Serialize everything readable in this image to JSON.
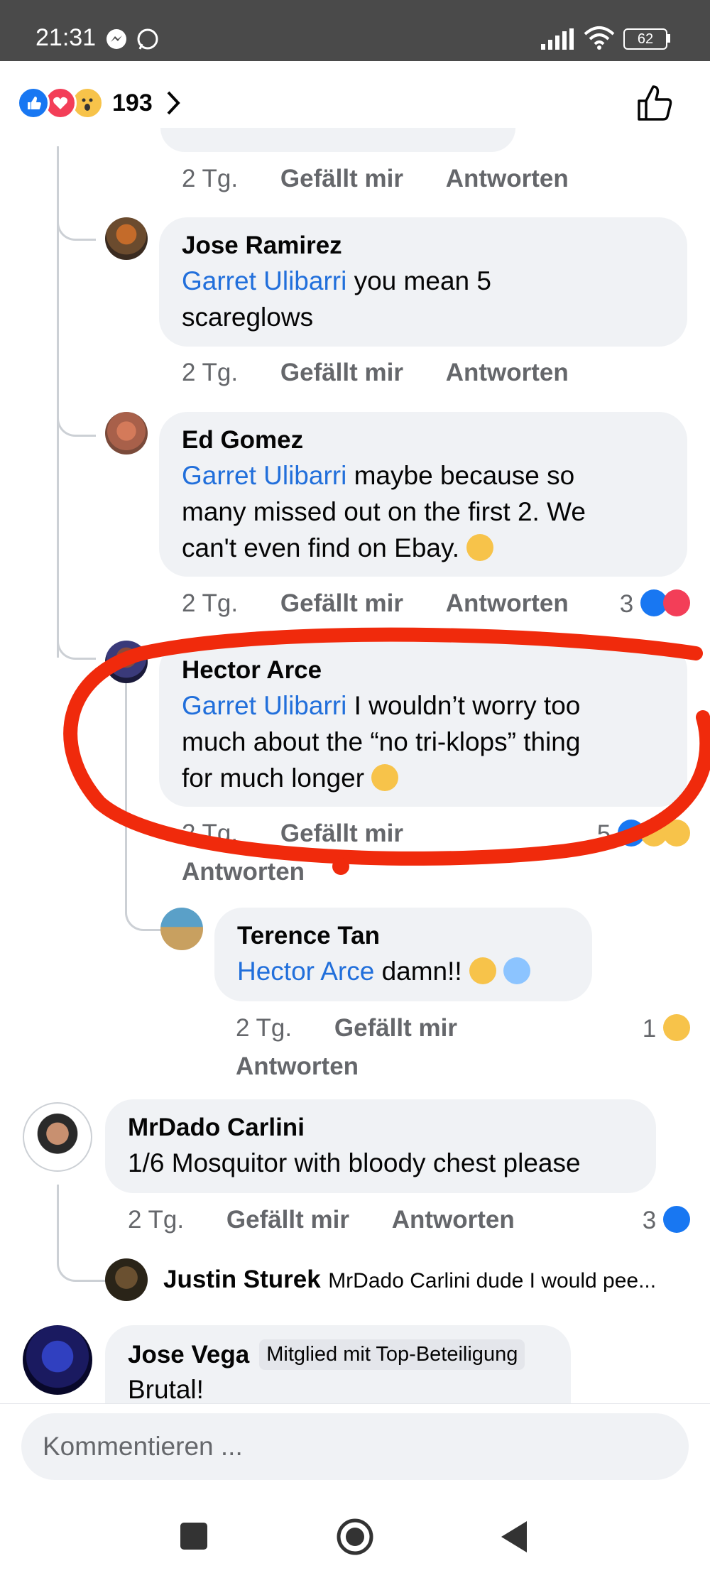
{
  "status_bar": {
    "time": "21:31",
    "battery": "62"
  },
  "header": {
    "reaction_count": "193"
  },
  "comments": [
    {
      "meta": {
        "time": "2 Tg.",
        "like": "Gefällt mir",
        "reply": "Antworten"
      }
    },
    {
      "name": "Jose Ramirez",
      "mention": "Garret Ulibarri",
      "text_lines": [
        "you mean 5",
        "scareglows"
      ],
      "meta": {
        "time": "2 Tg.",
        "like": "Gefällt mir",
        "reply": "Antworten"
      }
    },
    {
      "name": "Ed Gomez",
      "mention": "Garret Ulibarri",
      "text_lines": [
        "maybe because so",
        "many missed out on the first 2. We",
        "can't even find on Ebay."
      ],
      "meta": {
        "time": "2 Tg.",
        "like": "Gefällt mir",
        "reply": "Antworten",
        "reactions": "3"
      }
    },
    {
      "name": "Hector Arce",
      "mention": "Garret Ulibarri",
      "text_lines": [
        "I wouldn’t worry too",
        "much about the “no tri-klops” thing",
        "for much longer"
      ],
      "meta": {
        "time": "2 Tg.",
        "like": "Gefällt mir",
        "reply": "Antworten",
        "reactions": "5"
      }
    },
    {
      "name": "Terence Tan",
      "mention": "Hector Arce",
      "text": "damn!!",
      "meta": {
        "time": "2 Tg.",
        "like": "Gefällt mir",
        "reply": "Antworten",
        "reactions": "1"
      }
    },
    {
      "name": "MrDado Carlini",
      "text": "1/6 Mosquitor with bloody chest please",
      "meta": {
        "time": "2 Tg.",
        "like": "Gefällt mir",
        "reply": "Antworten",
        "reactions": "3"
      }
    },
    {
      "name": "Justin Sturek",
      "text": "MrDado Carlini dude I would pee..."
    },
    {
      "name": "Jose Vega",
      "badge": "Mitglied mit Top-Beteiligung",
      "text": "Brutal!"
    }
  ],
  "composer": {
    "placeholder": "Kommentieren ..."
  },
  "colors": {
    "accent_blue": "#1877f2",
    "mention": "#216fdb",
    "annotation_red": "#f02a0c"
  }
}
